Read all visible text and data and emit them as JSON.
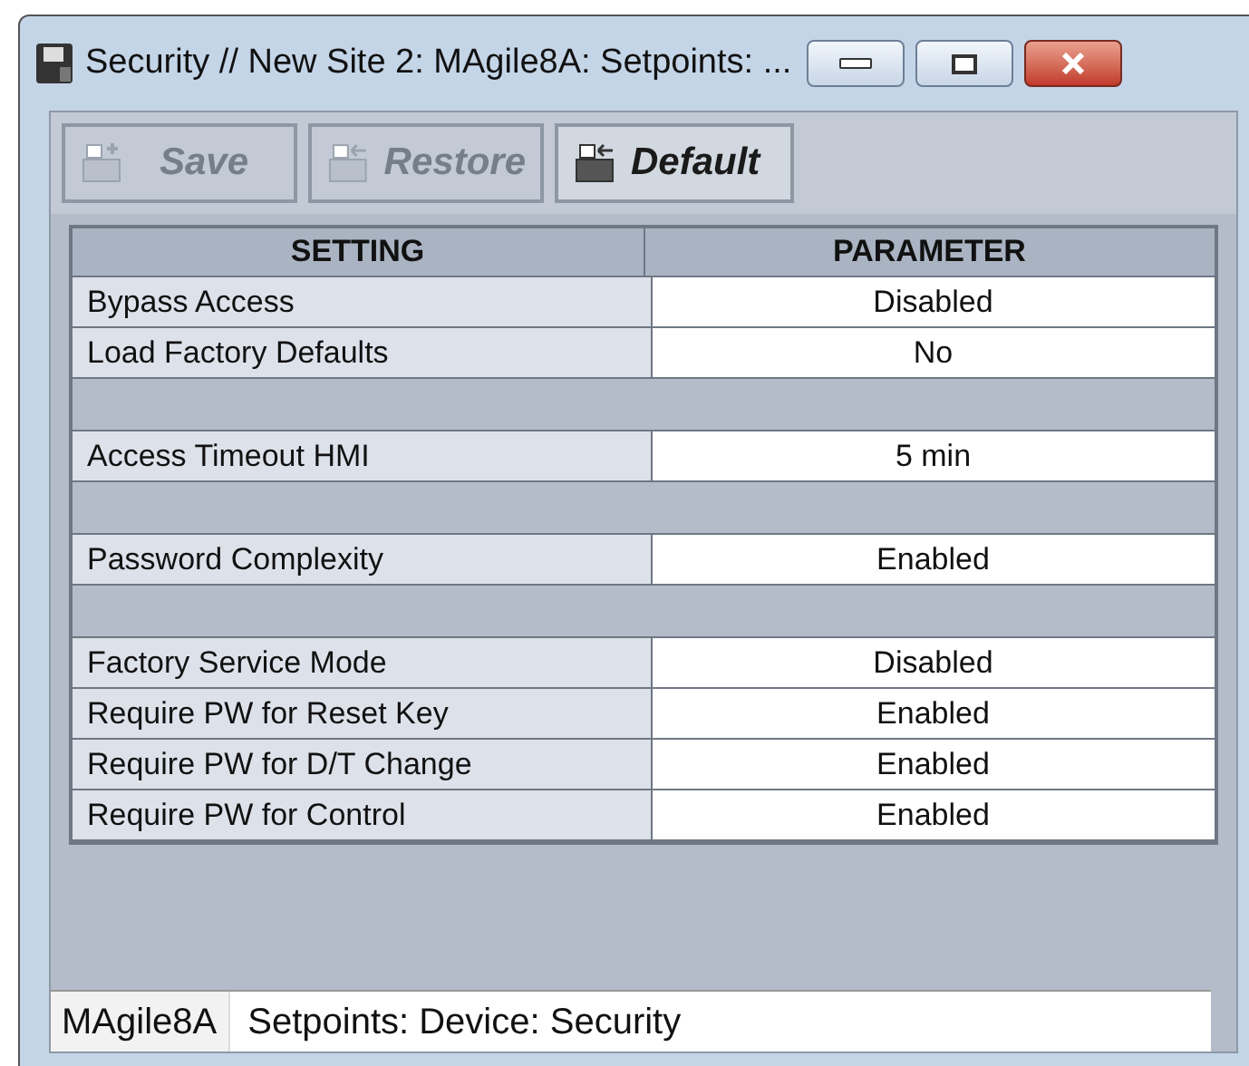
{
  "window": {
    "title": "Security // New Site 2: MAgile8A: Setpoints: ..."
  },
  "toolbar": [
    {
      "label": "Save",
      "disabled": true
    },
    {
      "label": "Restore",
      "disabled": true
    },
    {
      "label": "Default",
      "disabled": false
    }
  ],
  "table": {
    "columns": [
      "SETTING",
      "PARAMETER"
    ],
    "rows": [
      {
        "kind": "setting",
        "setting": "Bypass Access",
        "parameter": "Disabled"
      },
      {
        "kind": "setting",
        "setting": "Load Factory Defaults",
        "parameter": "No"
      },
      {
        "kind": "separator"
      },
      {
        "kind": "setting",
        "setting": "Access Timeout HMI",
        "parameter": "5 min"
      },
      {
        "kind": "separator"
      },
      {
        "kind": "setting",
        "setting": "Password Complexity",
        "parameter": "Enabled"
      },
      {
        "kind": "separator"
      },
      {
        "kind": "setting",
        "setting": "Factory Service Mode",
        "parameter": "Disabled"
      },
      {
        "kind": "setting",
        "setting": "Require PW for Reset Key",
        "parameter": "Enabled"
      },
      {
        "kind": "setting",
        "setting": "Require PW for D/T Change",
        "parameter": "Enabled"
      },
      {
        "kind": "setting",
        "setting": "Require PW for Control",
        "parameter": "Enabled"
      }
    ]
  },
  "status_bar": [
    "MAgile8A",
    "Setpoints: Device: Security"
  ]
}
